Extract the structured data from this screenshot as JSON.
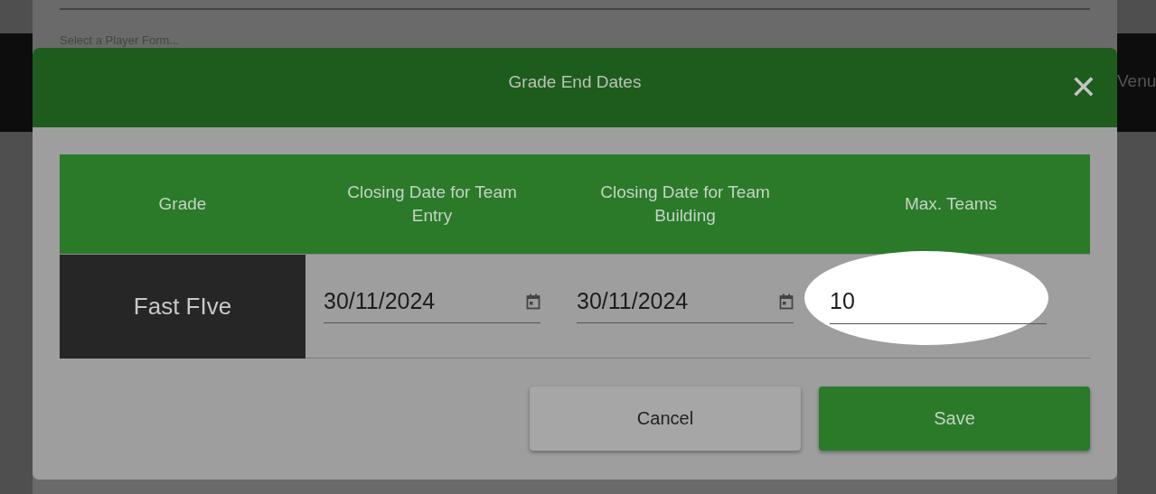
{
  "background": {
    "field_placeholder": "Select a Player Form...",
    "header_label": "Venu"
  },
  "dialog": {
    "title": "Grade End Dates",
    "close": "✕",
    "columns": [
      "Grade",
      "Closing Date for Team Entry",
      "Closing Date for Team Building",
      "Max. Teams"
    ],
    "rows": [
      {
        "grade": "Fast FIve",
        "entry_date": "30/11/2024",
        "building_date": "30/11/2024",
        "max_teams": "10",
        "highlighted": true
      }
    ],
    "buttons": [
      {
        "label": "Cancel",
        "kind": "secondary"
      },
      {
        "label": "Save",
        "kind": "primary"
      }
    ]
  }
}
